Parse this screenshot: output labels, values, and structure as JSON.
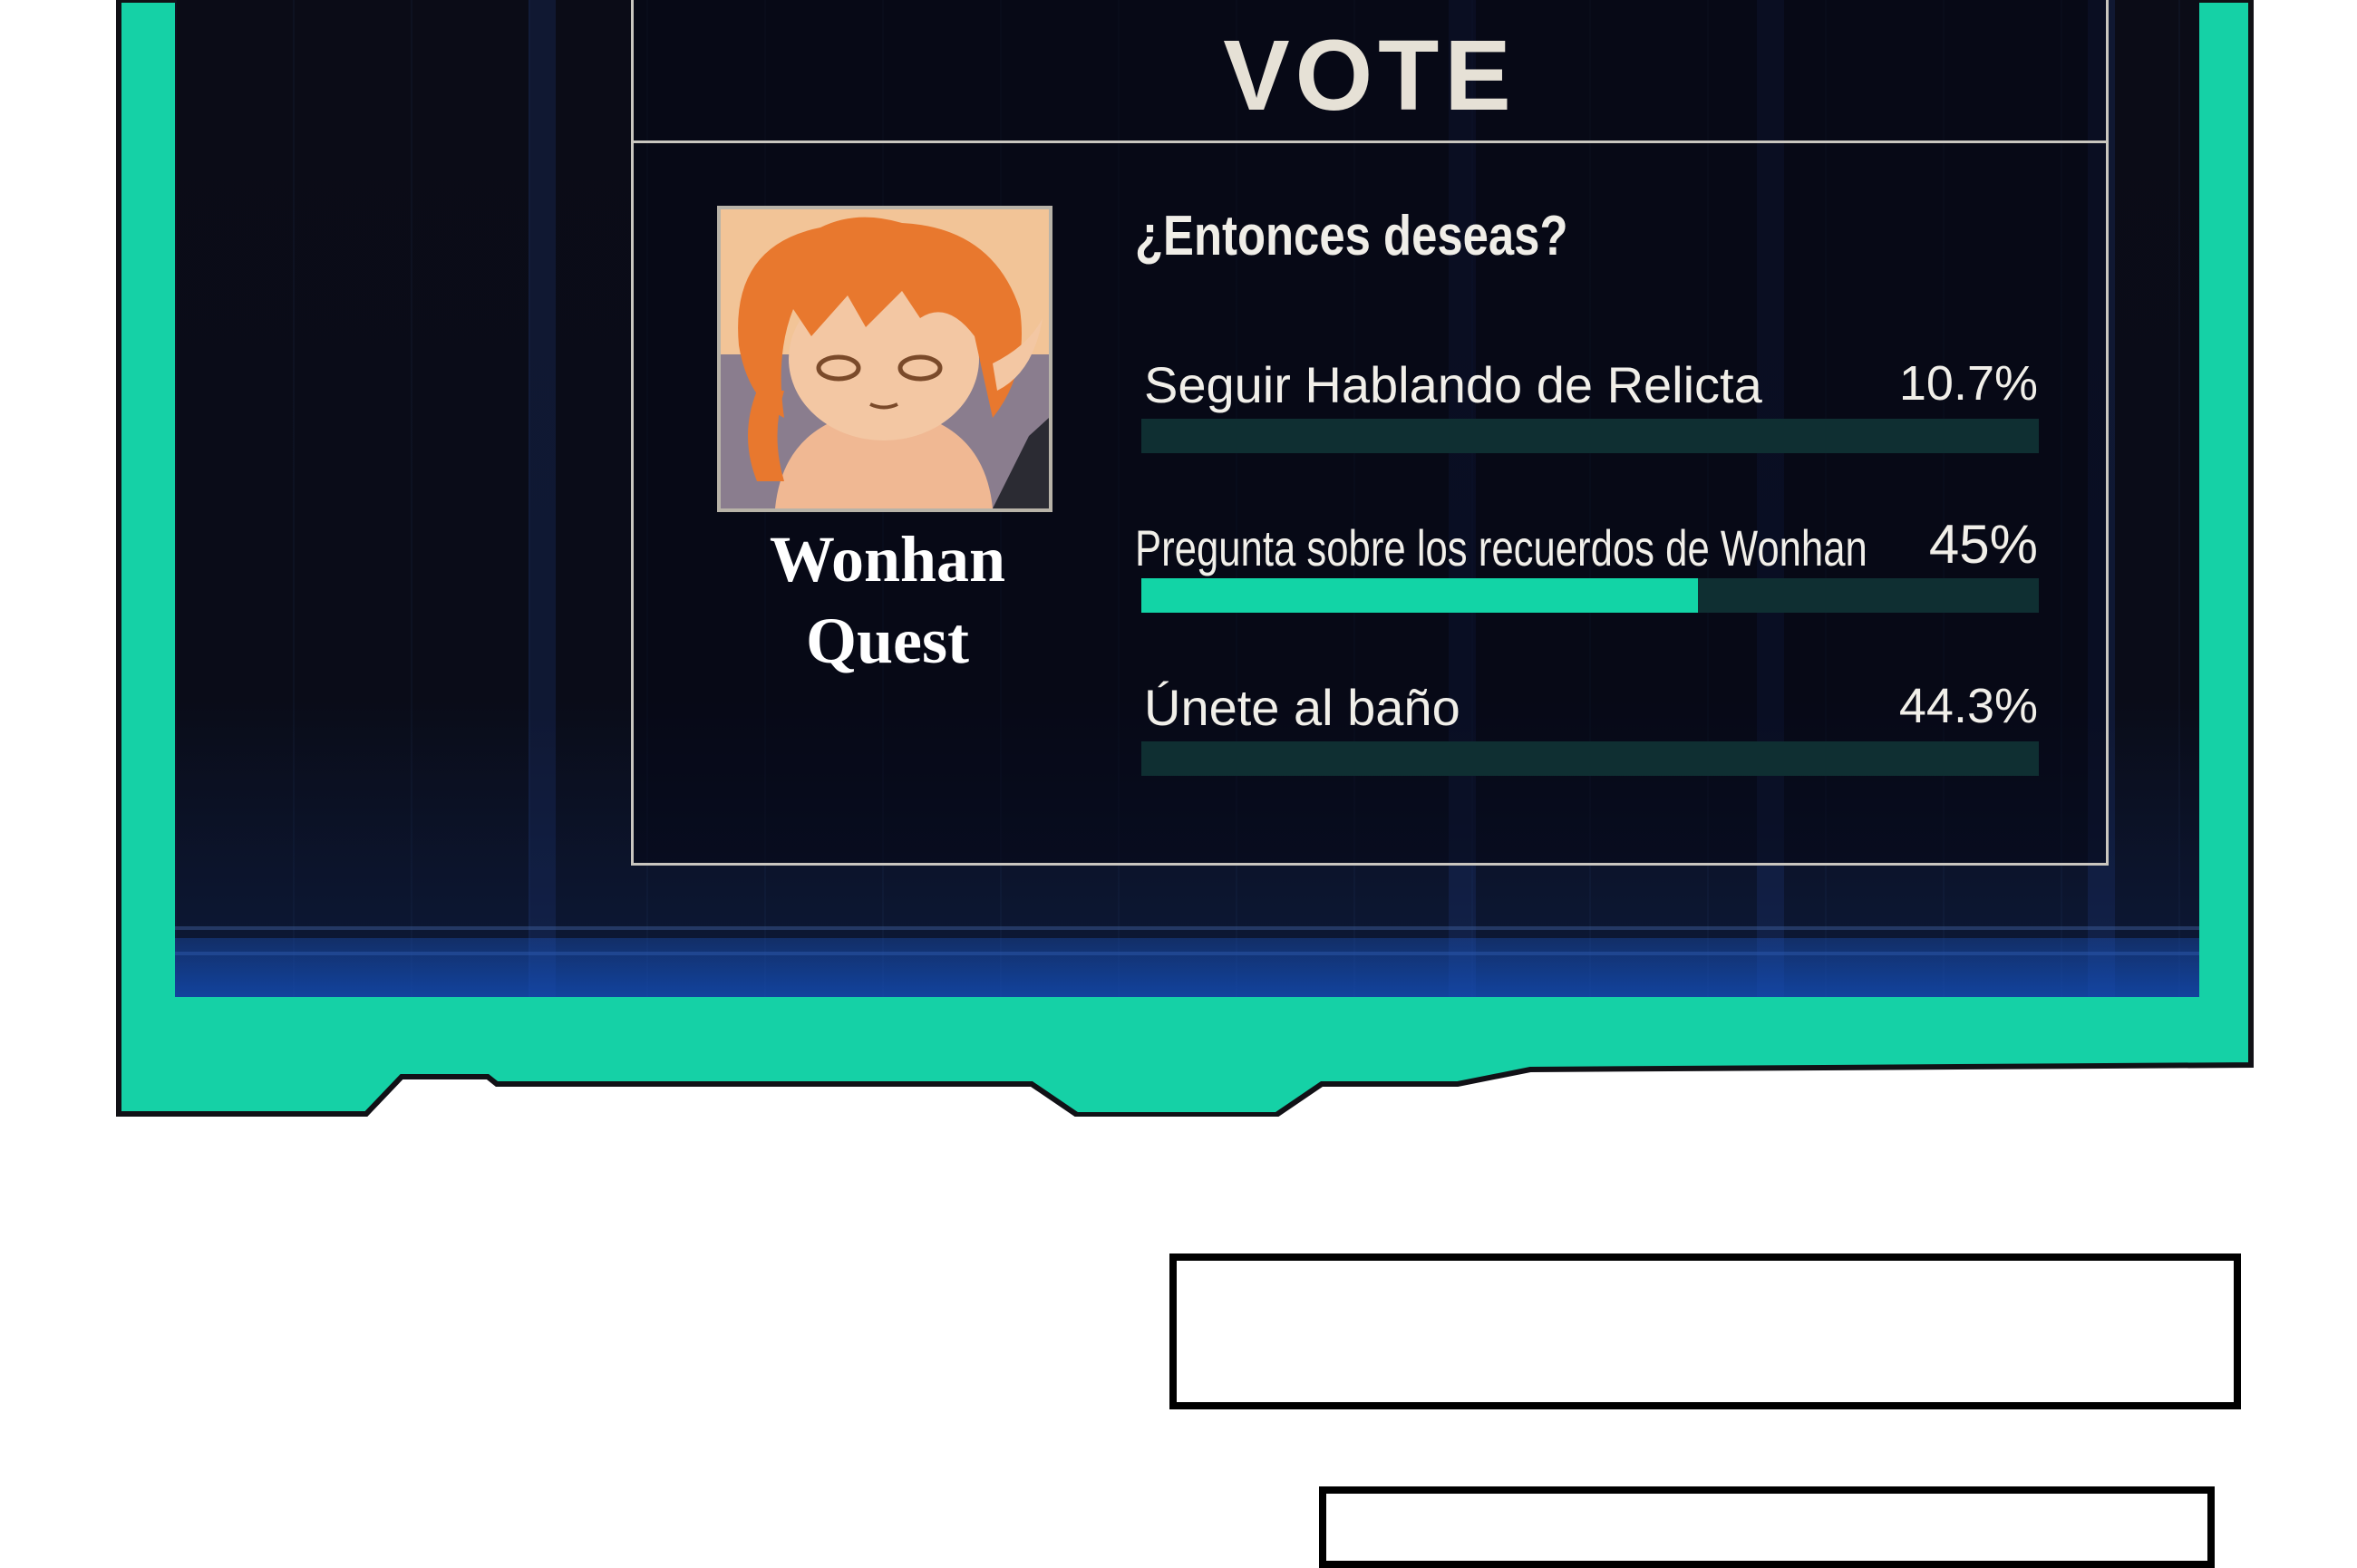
{
  "vote": {
    "title": "VOTE",
    "question": "¿Entonces deseas?",
    "quest_name_line1": "Wonhan",
    "quest_name_line2": "Quest",
    "options": [
      {
        "label": "Seguir Hablando de Relicta",
        "percent_text": "10.7%",
        "percent": 10.7,
        "fill_shown": 0
      },
      {
        "label": "Pregunta sobre los recuerdos de Wonhan",
        "percent_text": "45%",
        "percent": 45,
        "fill_shown": 62
      },
      {
        "label": "Únete al baño",
        "percent_text": "44.3%",
        "percent": 44.3,
        "fill_shown": 0
      }
    ]
  },
  "colors": {
    "accent": "#12d4a6",
    "frame_outline": "#111116",
    "panel_border": "#c9c6bf",
    "bar_track": "#0f2f32",
    "background": "#0a0c18"
  },
  "icons": {
    "avatar": "character-portrait-orange-hair"
  }
}
